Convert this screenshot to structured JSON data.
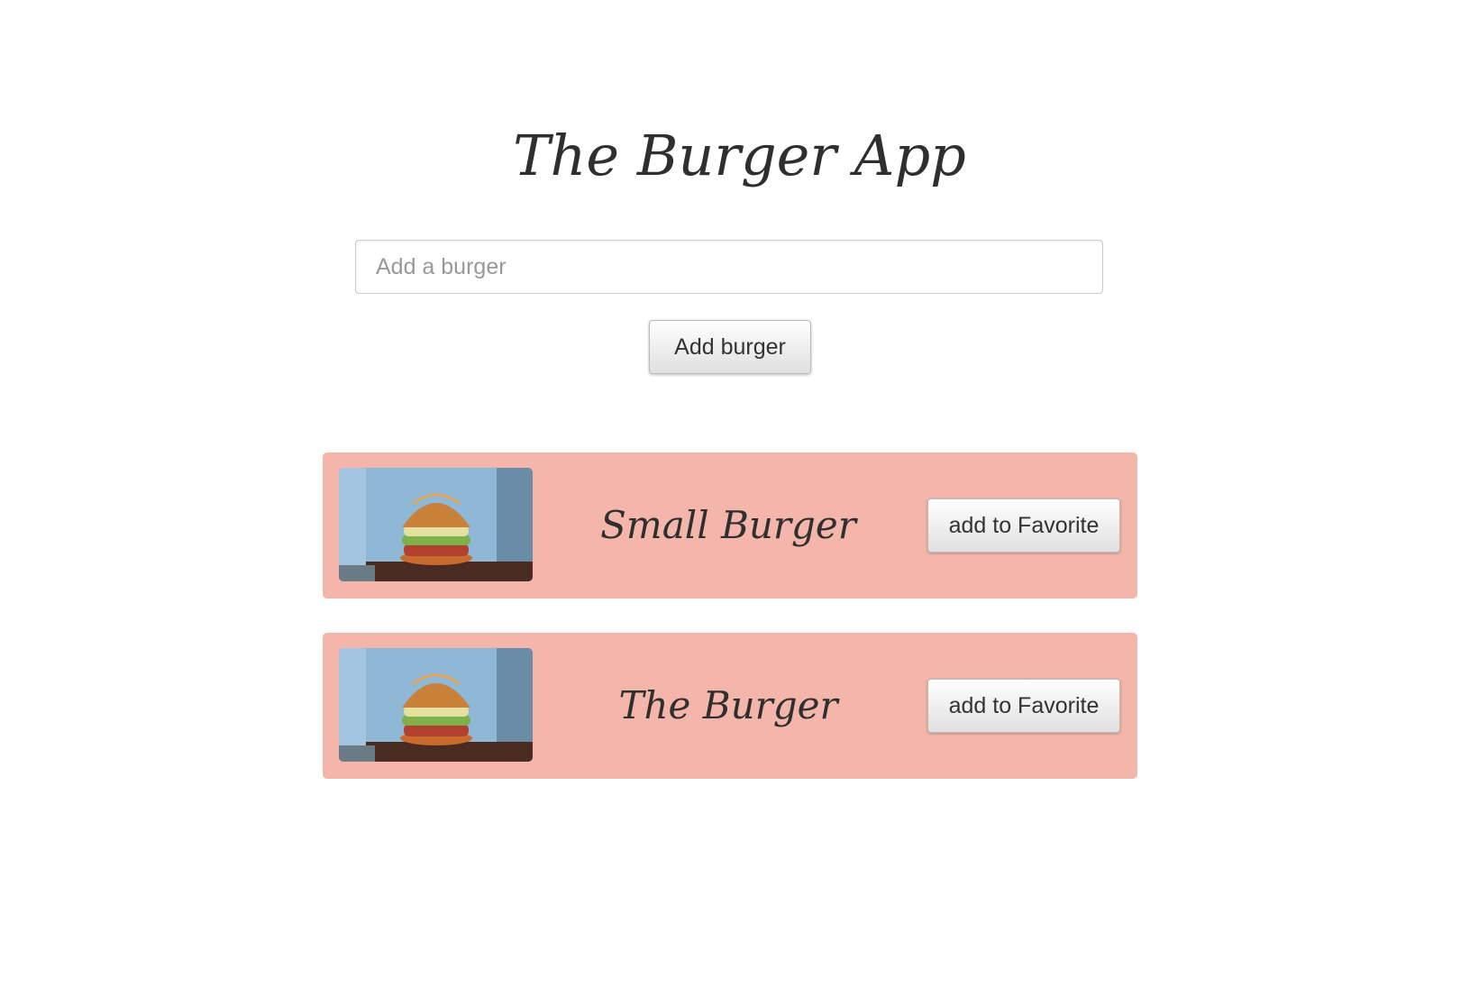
{
  "title": "The Burger App",
  "add_form": {
    "input_placeholder": "Add a burger",
    "input_value": "",
    "button_label": "Add burger"
  },
  "burgers": [
    {
      "name": "Small Burger",
      "button_label": "add to Favorite",
      "image": "burger-photo"
    },
    {
      "name": "The Burger",
      "button_label": "add to Favorite",
      "image": "burger-photo"
    }
  ],
  "colors": {
    "card_background": "#f4b6aa",
    "text": "#2f2f2f"
  }
}
